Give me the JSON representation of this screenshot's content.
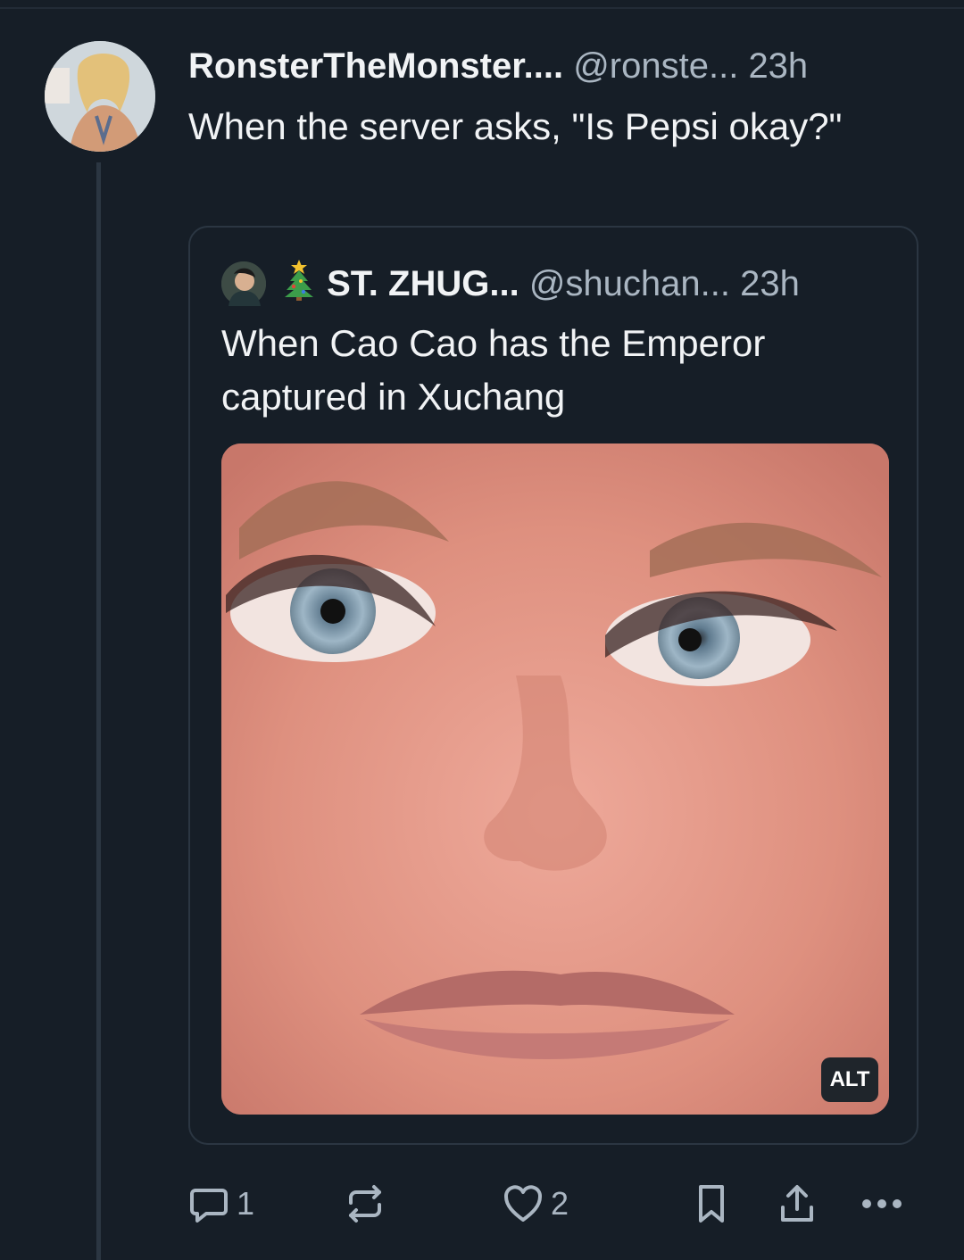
{
  "post": {
    "display_name": "RonsterTheMonster....",
    "handle": "@ronste...",
    "time": "23h",
    "text": "When the server asks, \"Is Pepsi okay?\""
  },
  "quote": {
    "display_name": "ST. ZHUG...",
    "handle": "@shuchan...",
    "time": "23h",
    "text": "When Cao Cao has the Emperor captured in Xuchang",
    "alt_label": "ALT"
  },
  "actions": {
    "reply_count": "1",
    "like_count": "2"
  },
  "icons": {
    "reply": "comment-icon",
    "repost": "repost-icon",
    "like": "heart-icon",
    "bookmark": "bookmark-icon",
    "share": "share-icon",
    "more": "more-icon",
    "decoration": "christmas-tree-icon"
  }
}
